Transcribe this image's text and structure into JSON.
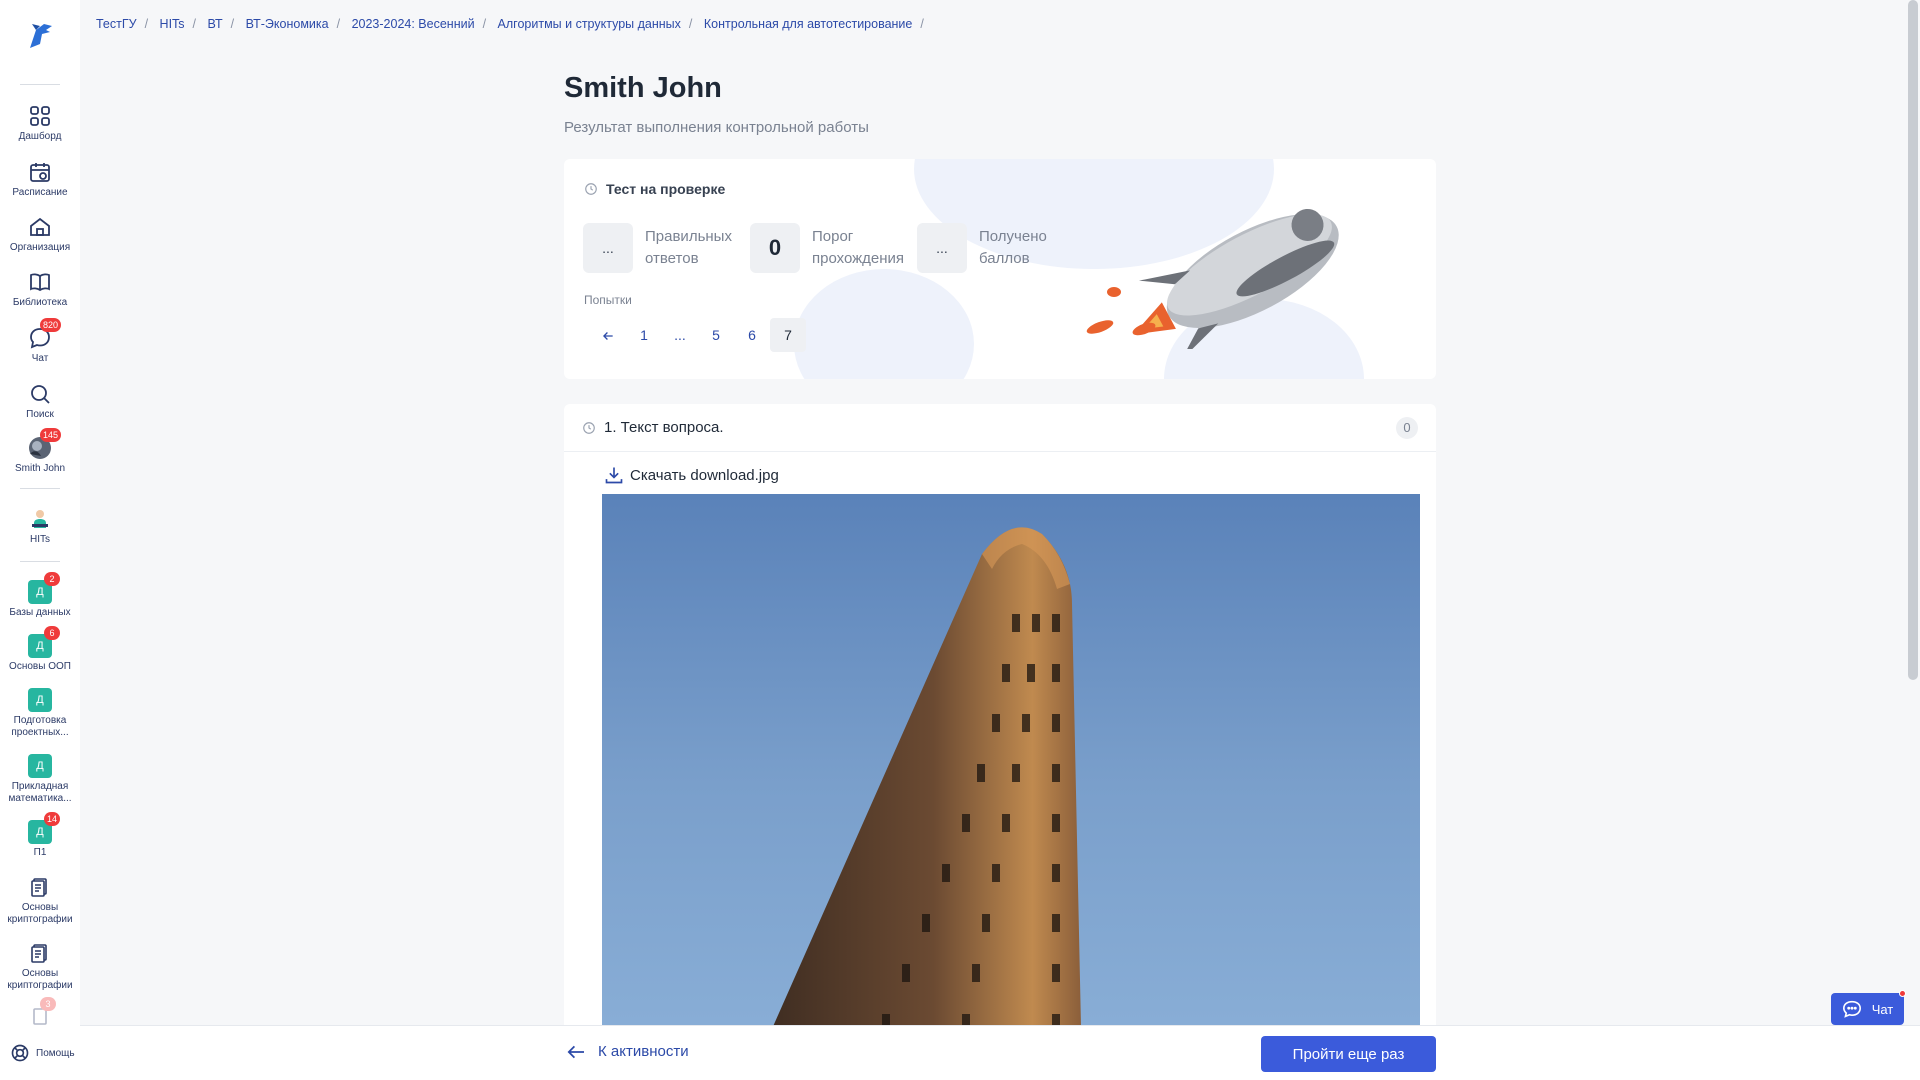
{
  "breadcrumbs": [
    "ТестГУ",
    "HITs",
    "ВТ",
    "ВТ-Экономика",
    "2023-2024: Весенний",
    "Алгоритмы и структуры данных",
    "Контрольная для автотестирование"
  ],
  "sidebar": {
    "items": [
      {
        "label": "Дашборд",
        "icon": "grid-icon"
      },
      {
        "label": "Расписание",
        "icon": "calendar-icon"
      },
      {
        "label": "Организация",
        "icon": "home-icon"
      },
      {
        "label": "Библиотека",
        "icon": "book-icon"
      },
      {
        "label": "Чат",
        "icon": "chat-icon",
        "badge": "820"
      },
      {
        "label": "Поиск",
        "icon": "search-icon"
      },
      {
        "label": "Smith John",
        "icon": "avatar",
        "badge": "145"
      },
      {
        "label": "HITs",
        "icon": "hits-icon"
      }
    ],
    "courses": [
      {
        "letter": "Д",
        "label": "Базы данных",
        "badge": "2"
      },
      {
        "letter": "Д",
        "label": "Основы ООП",
        "badge": "6"
      },
      {
        "letter": "Д",
        "label": "Подготовка проектных...",
        "badge": ""
      },
      {
        "letter": "Д",
        "label": "Прикладная математика...",
        "badge": ""
      },
      {
        "letter": "Д",
        "label": "П1",
        "badge": "14"
      },
      {
        "letter": "",
        "label": "Основы криптографии",
        "badge": ""
      },
      {
        "letter": "",
        "label": "Основы криптографии",
        "badge": ""
      },
      {
        "letter": "",
        "label": "",
        "badge": "3"
      }
    ],
    "help_label": "Помощь"
  },
  "page": {
    "title": "Smith John",
    "subtitle": "Результат выполнения контрольной работы"
  },
  "result": {
    "status": "Тест на проверке",
    "stats": [
      {
        "value": "...",
        "label": "Правильных ответов"
      },
      {
        "value": "0",
        "label": "Порог прохождения"
      },
      {
        "value": "...",
        "label": "Получено баллов"
      }
    ],
    "attempts_label": "Попытки",
    "pages": [
      "1",
      "...",
      "5",
      "6",
      "7"
    ],
    "active_page": "7"
  },
  "question": {
    "title": "1. Текст вопроса.",
    "score": "0",
    "download_label": "Скачать download.jpg"
  },
  "footer": {
    "back_label": "К активности",
    "retry_label": "Пройти еще раз"
  },
  "chat_fab": {
    "label": "Чат"
  },
  "colors": {
    "accent": "#3b5bdb",
    "link": "#2c4aa8",
    "badge": "#ef3b3b",
    "course": "#27b6a0"
  }
}
